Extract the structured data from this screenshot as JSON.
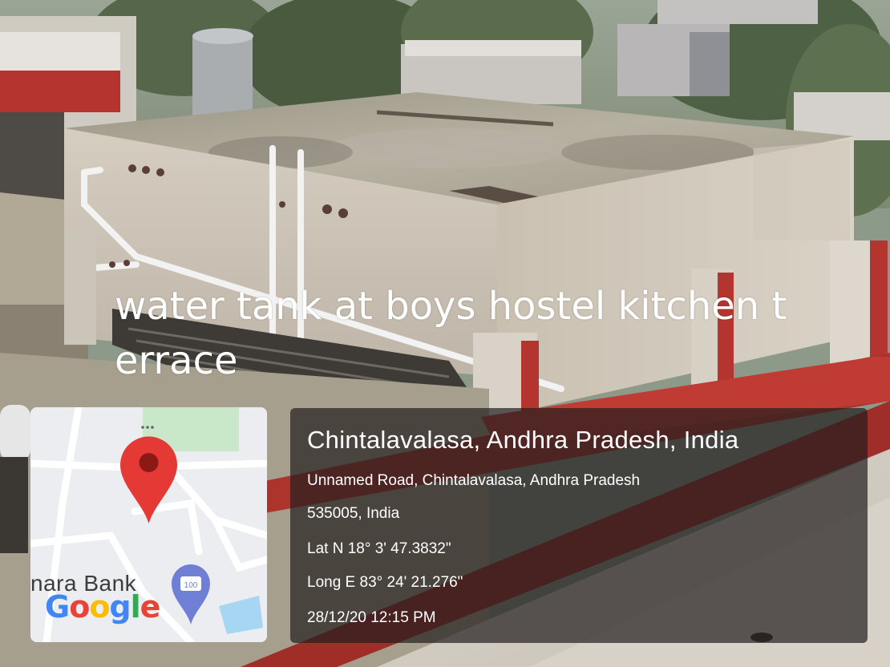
{
  "caption": "water tank at boys hostel kitchen terrace",
  "location": {
    "place": "Chintalavalasa, Andhra Pradesh, India",
    "address_line1": "Unnamed Road, Chintalavalasa, Andhra Pradesh",
    "address_line2": "535005, India",
    "latitude": "Lat N 18° 3' 47.3832\"",
    "longitude": "Long E 83° 24' 21.276\"",
    "timestamp": "28/12/20 12:15 PM"
  },
  "map": {
    "partial_label": "nara Bank",
    "logo": "Google",
    "badge_text": "100",
    "pin_color": "#e53935"
  }
}
